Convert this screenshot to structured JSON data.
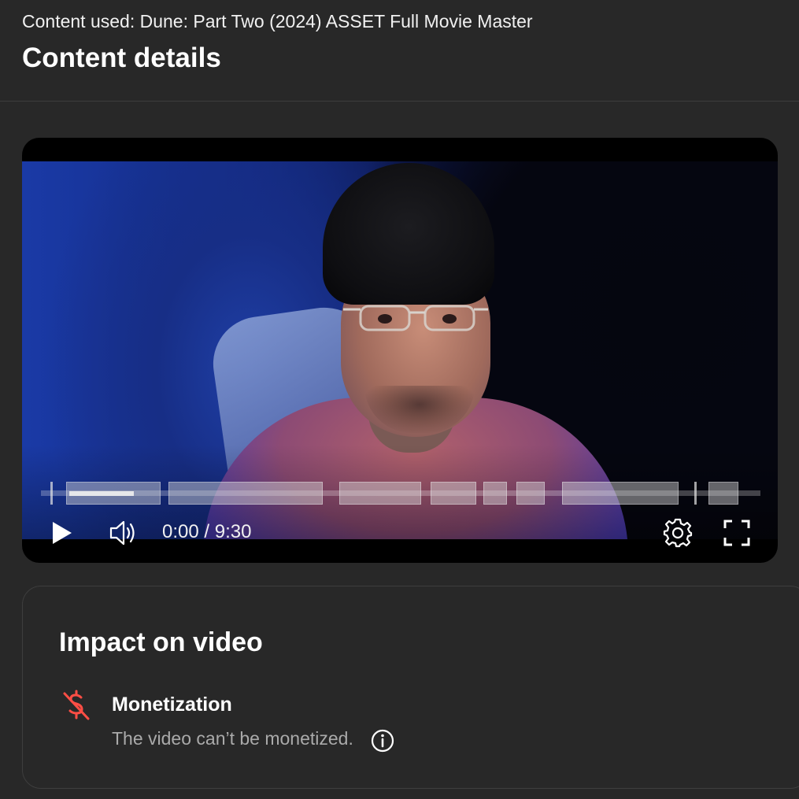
{
  "header": {
    "content_used": "Content used: Dune: Part Two (2024) ASSET Full Movie Master",
    "title": "Content details"
  },
  "player": {
    "current_time": "0:00",
    "duration": "9:30",
    "time_display": "0:00 / 9:30",
    "playing": false,
    "icons": {
      "play": "play-icon",
      "volume": "volume-icon",
      "settings": "gear-icon",
      "fullscreen": "fullscreen-icon"
    }
  },
  "impact": {
    "title": "Impact on video",
    "items": [
      {
        "label": "Monetization",
        "description": "The video can’t be monetized.",
        "icon": "no-money-icon",
        "icon_color": "#ff4e45"
      }
    ]
  },
  "colors": {
    "background": "#282828",
    "accent_error": "#ff4e45",
    "text_secondary": "#aaaaaa"
  }
}
